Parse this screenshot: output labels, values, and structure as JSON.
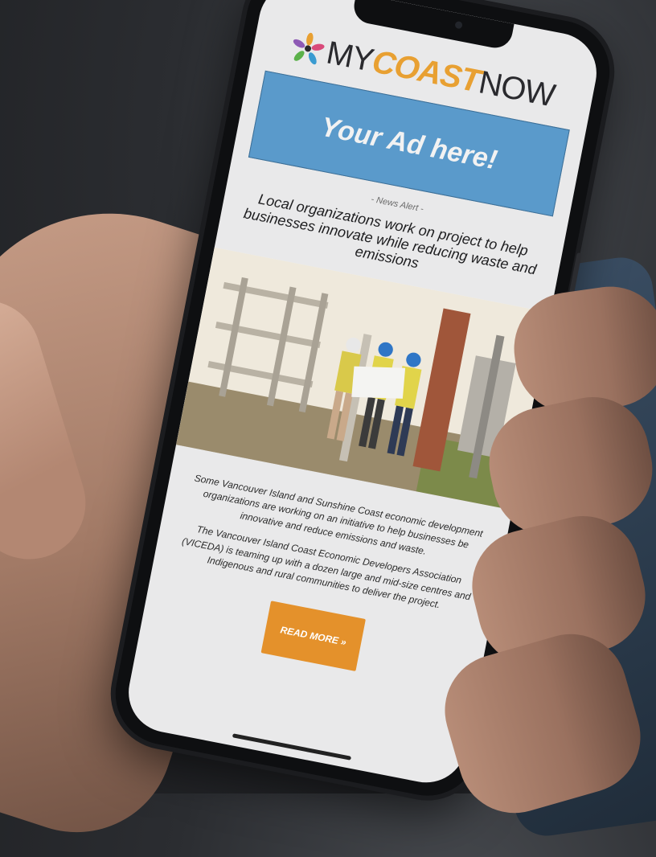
{
  "logo": {
    "my": "MY",
    "coast": "COAST",
    "now": "NOW"
  },
  "ad": {
    "text": "Your Ad here!"
  },
  "news": {
    "alert_label": "- News Alert -",
    "headline": "Local organizations work on project to help businesses innovate while reducing waste and emissions"
  },
  "article": {
    "paragraph1": "Some Vancouver Island and Sunshine Coast economic development organizations are working on an initiative to help businesses be innovative and reduce emissions and waste.",
    "paragraph2": "The Vancouver Island Coast Economic Developers Association (VICEDA) is teaming up with a dozen large and mid-size centres and Indigenous and rural communities to deliver the project."
  },
  "cta": {
    "read_more": "READ MORE »"
  },
  "colors": {
    "accent": "#e4912b",
    "ad_bg": "#5a9acb",
    "screen_bg": "#e9e9ea"
  }
}
